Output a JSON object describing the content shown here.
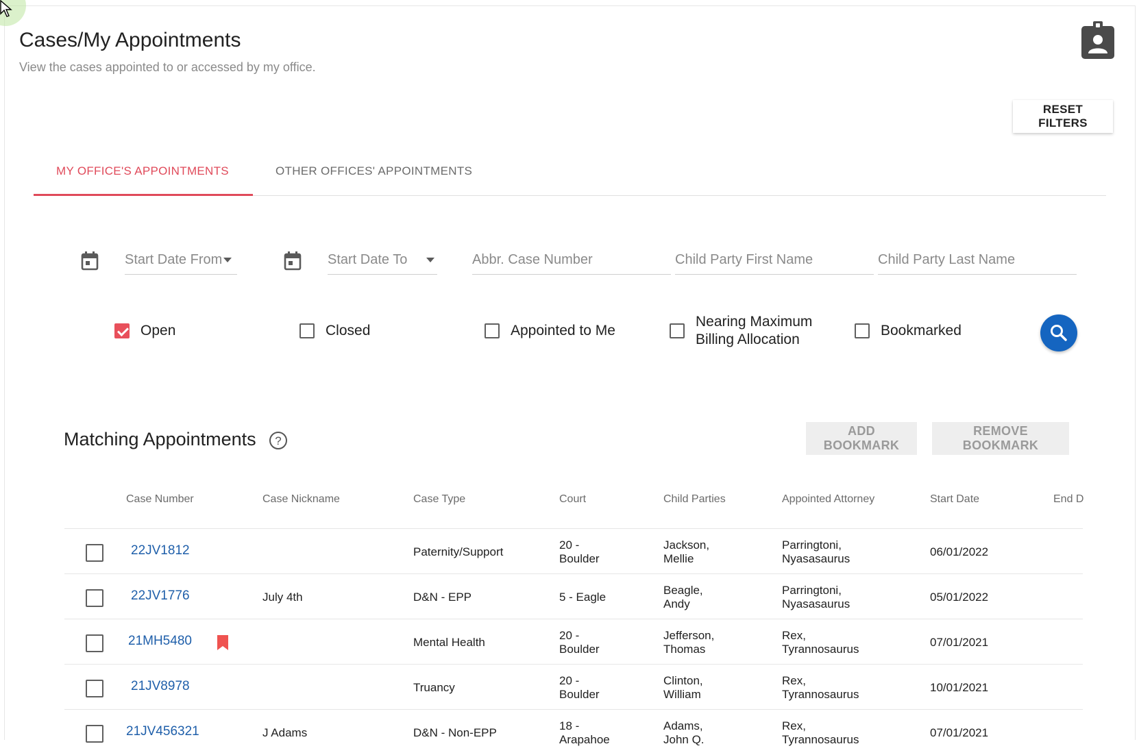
{
  "page": {
    "title": "Cases/My Appointments",
    "subtitle": "View the cases appointed to or accessed by my office."
  },
  "actions": {
    "reset_filters": "RESET FILTERS"
  },
  "tabs": [
    {
      "label": "MY OFFICE'S APPOINTMENTS",
      "active": true
    },
    {
      "label": "OTHER OFFICES' APPOINTMENTS",
      "active": false
    }
  ],
  "filters": {
    "start_date_from": "Start Date From",
    "start_date_to": "Start Date To",
    "case_number": "Abbr. Case Number",
    "child_first_name": "Child Party First Name",
    "child_last_name": "Child Party Last Name",
    "checkboxes": [
      {
        "label": "Open",
        "checked": true
      },
      {
        "label": "Closed",
        "checked": false
      },
      {
        "label": "Appointed to Me",
        "checked": false
      },
      {
        "label_line1": "Nearing Maximum",
        "label_line2": "Billing Allocation",
        "checked": false
      },
      {
        "label": "Bookmarked",
        "checked": false
      }
    ],
    "search_icon": "search-icon"
  },
  "results": {
    "title": "Matching Appointments",
    "add_bookmark": "ADD BOOKMARK",
    "remove_bookmark": "REMOVE BOOKMARK",
    "columns": [
      "Case Number",
      "Case Nickname",
      "Case Type",
      "Court",
      "Child Parties",
      "Appointed Attorney",
      "Start Date",
      "End D"
    ],
    "rows": [
      {
        "case_number": "22JV1812",
        "nickname": "",
        "case_type": "Paternity/Support",
        "court_1": "20 -",
        "court_2": "Boulder",
        "child_1": "Jackson,",
        "child_2": "Mellie",
        "attorney_1": "Parringtoni,",
        "attorney_2": "Nyasasaurus",
        "start_date": "06/01/2022",
        "bookmarked": false
      },
      {
        "case_number": "22JV1776",
        "nickname": "July 4th",
        "case_type": "D&N - EPP",
        "court_1": "5 - Eagle",
        "court_2": "",
        "child_1": "Beagle,",
        "child_2": "Andy",
        "attorney_1": "Parringtoni,",
        "attorney_2": "Nyasasaurus",
        "start_date": "05/01/2022",
        "bookmarked": false
      },
      {
        "case_number": "21MH5480",
        "nickname": "",
        "case_type": "Mental Health",
        "court_1": "20 -",
        "court_2": "Boulder",
        "child_1": "Jefferson,",
        "child_2": "Thomas",
        "attorney_1": "Rex,",
        "attorney_2": "Tyrannosaurus",
        "start_date": "07/01/2021",
        "bookmarked": true
      },
      {
        "case_number": "21JV8978",
        "nickname": "",
        "case_type": "Truancy",
        "court_1": "20 -",
        "court_2": "Boulder",
        "child_1": "Clinton,",
        "child_2": "William",
        "attorney_1": "Rex,",
        "attorney_2": "Tyrannosaurus",
        "start_date": "10/01/2021",
        "bookmarked": false
      },
      {
        "case_number": "21JV456321",
        "nickname": "J Adams",
        "case_type": "D&N - Non-EPP",
        "court_1": "18 -",
        "court_2": "Arapahoe",
        "child_1": "Adams,",
        "child_2": "John Q.",
        "attorney_1": "Rex,",
        "attorney_2": "Tyrannosaurus",
        "start_date": "07/01/2021",
        "bookmarked": false
      }
    ]
  },
  "colors": {
    "accent": "#e04a5a",
    "primary": "#1565c0",
    "link": "#1f5faa"
  }
}
